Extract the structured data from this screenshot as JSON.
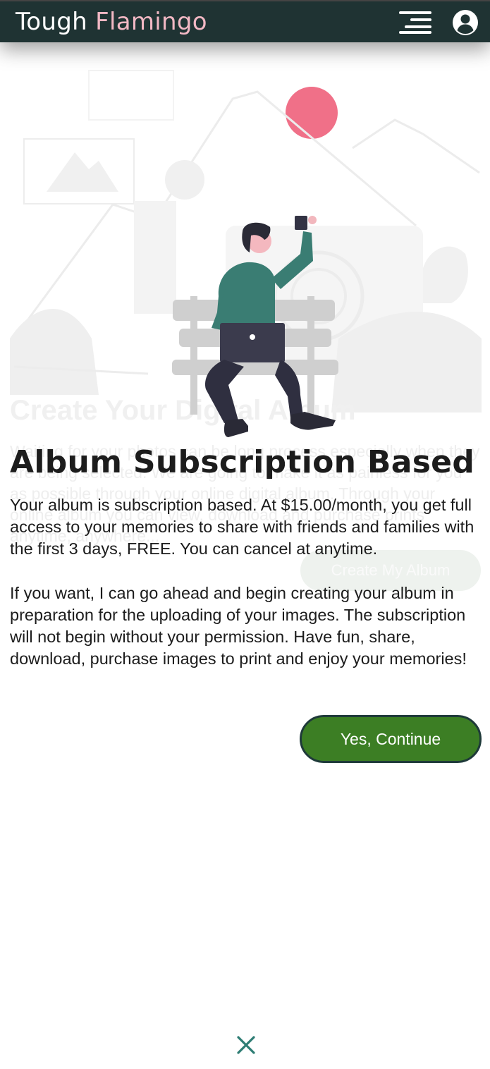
{
  "header": {
    "brand_part1": "Tough",
    "brand_part2": "Flamingo",
    "menu_icon": "hamburger-menu-icon",
    "account_icon": "user-circle-icon"
  },
  "background": {
    "heading": "Create Your Digital Album",
    "paragraph": "Waiting for your photos can be long process especially when they are being selected. We are going to make it as painless for you as possible through your online digital album. Through your online album you can view, download and purchase prints anytime, anywhere...",
    "button_label": "Create My Album"
  },
  "modal": {
    "title": "Album Subscription Based",
    "paragraph1": "Your album is subscription based. At $15.00/month, you get full access to your memories to share with friends and families with the first 3 days, FREE. You can cancel at anytime.",
    "paragraph2": "If you want, I can go ahead and begin creating your album in preparation for the uploading of your images. The subscription will not begin without your permission. Have fun, share, download, purchase images to print and enjoy your memories!",
    "continue_label": "Yes, Continue",
    "close_icon": "close-x-icon"
  },
  "colors": {
    "header_bg": "#1f3333",
    "brand_accent": "#f2b8c4",
    "button_green": "#3c7e24",
    "close_teal": "#2e7d74",
    "sun_pink": "#f07088",
    "shirt_teal": "#3a7d73"
  }
}
